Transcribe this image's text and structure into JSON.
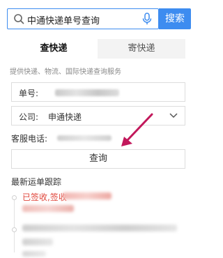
{
  "search": {
    "query": "中通快递单号查询",
    "button_label": "搜索"
  },
  "tabs": [
    {
      "label": "查快递"
    },
    {
      "label": "寄快递"
    }
  ],
  "services_text": "提供快递、物流、国际快递查询服务",
  "form": {
    "tracking_label": "单号:",
    "company_label": "公司:",
    "company_value": "申通快递",
    "phone_label": "客服电话:"
  },
  "query_button": "查询",
  "recent_title": "最新运单跟踪",
  "timeline": [
    {
      "text": "已签收,签收"
    }
  ],
  "colors": {
    "accent": "#3d8cf0",
    "tracking_red": "#e0463b",
    "arrow": "#c2185b"
  }
}
